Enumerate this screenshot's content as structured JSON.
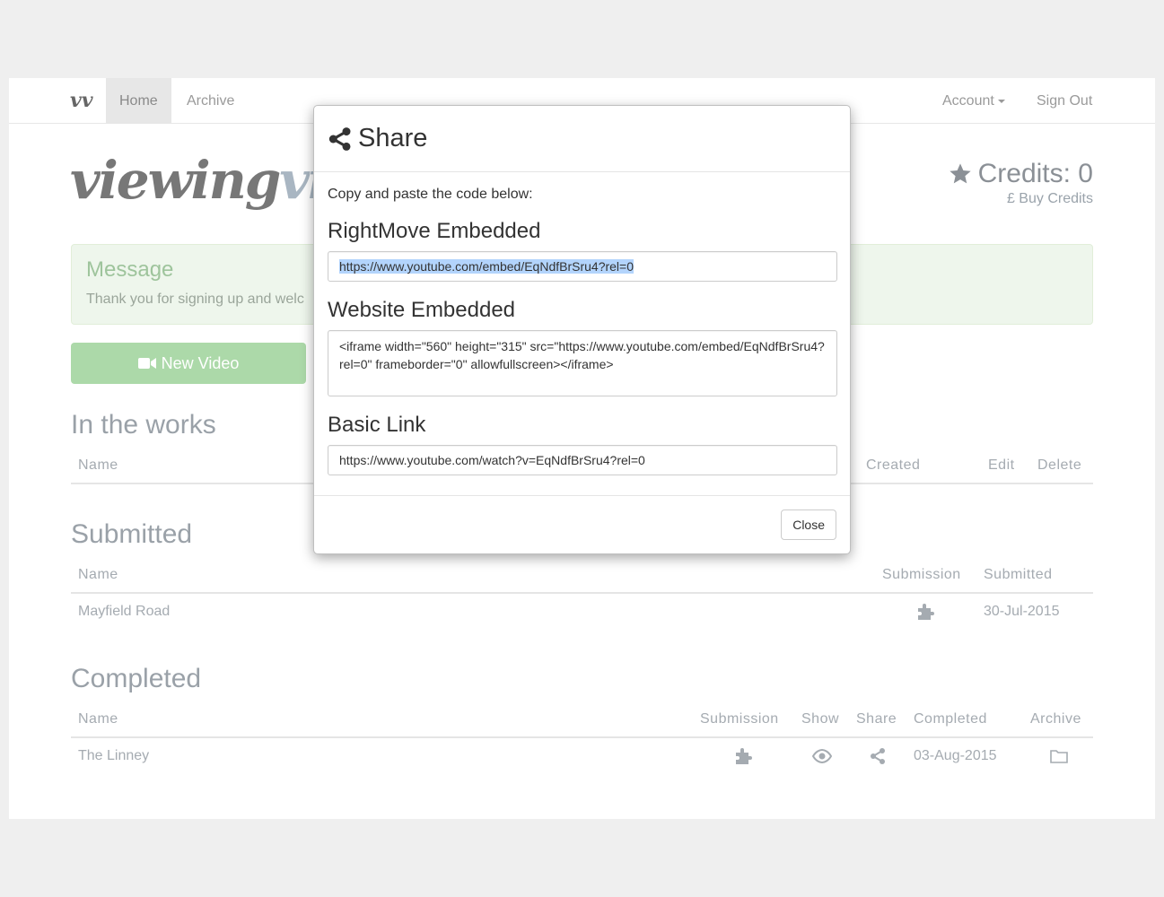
{
  "nav": {
    "brand": "vv",
    "home": "Home",
    "archive": "Archive",
    "account": "Account",
    "sign_out": "Sign Out"
  },
  "logo": {
    "part1": "viewing",
    "part2": "vide"
  },
  "credits": {
    "label": "Credits: 0",
    "buy": "£ Buy Credits"
  },
  "alert": {
    "title": "Message",
    "text": "Thank you for signing up and welc"
  },
  "new_video": "New Video",
  "in_the_works": {
    "title": "In the works",
    "headers": {
      "name": "Name",
      "created": "Created",
      "edit": "Edit",
      "delete": "Delete"
    }
  },
  "submitted": {
    "title": "Submitted",
    "headers": {
      "name": "Name",
      "submission": "Submission",
      "submitted": "Submitted"
    },
    "rows": [
      {
        "name": "Mayfield Road",
        "submitted": "30-Jul-2015"
      }
    ]
  },
  "completed": {
    "title": "Completed",
    "headers": {
      "name": "Name",
      "submission": "Submission",
      "show": "Show",
      "share": "Share",
      "completed": "Completed",
      "archive": "Archive"
    },
    "rows": [
      {
        "name": "The Linney",
        "completed": "03-Aug-2015"
      }
    ]
  },
  "modal": {
    "title": "Share",
    "intro": "Copy and paste the code below:",
    "rightmove_label": "RightMove Embedded",
    "rightmove_value": "https://www.youtube.com/embed/EqNdfBrSru4?rel=0",
    "website_label": "Website Embedded",
    "website_value": "<iframe width=\"560\" height=\"315\" src=\"https://www.youtube.com/embed/EqNdfBrSru4?rel=0\" frameborder=\"0\" allowfullscreen></iframe>",
    "basic_label": "Basic Link",
    "basic_value": "https://www.youtube.com/watch?v=EqNdfBrSru4?rel=0",
    "close": "Close"
  },
  "icons": {
    "brand": "vv-logo-icon",
    "star": "star-icon",
    "camera": "video-camera-icon",
    "puzzle": "puzzle-icon",
    "eye": "eye-icon",
    "share": "share-icon",
    "folder": "folder-icon"
  }
}
